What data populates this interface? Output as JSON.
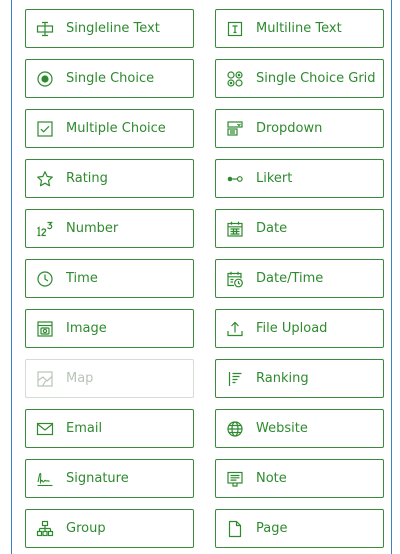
{
  "colors": {
    "accent": "#2f8a2f",
    "border": "#3b8a3b",
    "disabled": "#b8c4b8",
    "frame": "#3b82c4"
  },
  "items": [
    {
      "label": "Singleline Text",
      "icon": "singleline-text-icon"
    },
    {
      "label": "Multiline Text",
      "icon": "multiline-text-icon"
    },
    {
      "label": "Single Choice",
      "icon": "radio-icon"
    },
    {
      "label": "Single Choice Grid",
      "icon": "choice-grid-icon"
    },
    {
      "label": "Multiple Choice",
      "icon": "checkbox-icon"
    },
    {
      "label": "Dropdown",
      "icon": "dropdown-icon"
    },
    {
      "label": "Rating",
      "icon": "star-icon"
    },
    {
      "label": "Likert",
      "icon": "likert-icon"
    },
    {
      "label": "Number",
      "icon": "number-icon"
    },
    {
      "label": "Date",
      "icon": "calendar-icon"
    },
    {
      "label": "Time",
      "icon": "clock-icon"
    },
    {
      "label": "Date/Time",
      "icon": "calendar-clock-icon"
    },
    {
      "label": "Image",
      "icon": "image-icon"
    },
    {
      "label": "File Upload",
      "icon": "upload-icon"
    },
    {
      "label": "Map",
      "icon": "map-icon",
      "disabled": true
    },
    {
      "label": "Ranking",
      "icon": "ranking-icon"
    },
    {
      "label": "Email",
      "icon": "envelope-icon"
    },
    {
      "label": "Website",
      "icon": "globe-icon"
    },
    {
      "label": "Signature",
      "icon": "signature-icon"
    },
    {
      "label": "Note",
      "icon": "note-icon"
    },
    {
      "label": "Group",
      "icon": "group-icon"
    },
    {
      "label": "Page",
      "icon": "page-icon"
    }
  ]
}
